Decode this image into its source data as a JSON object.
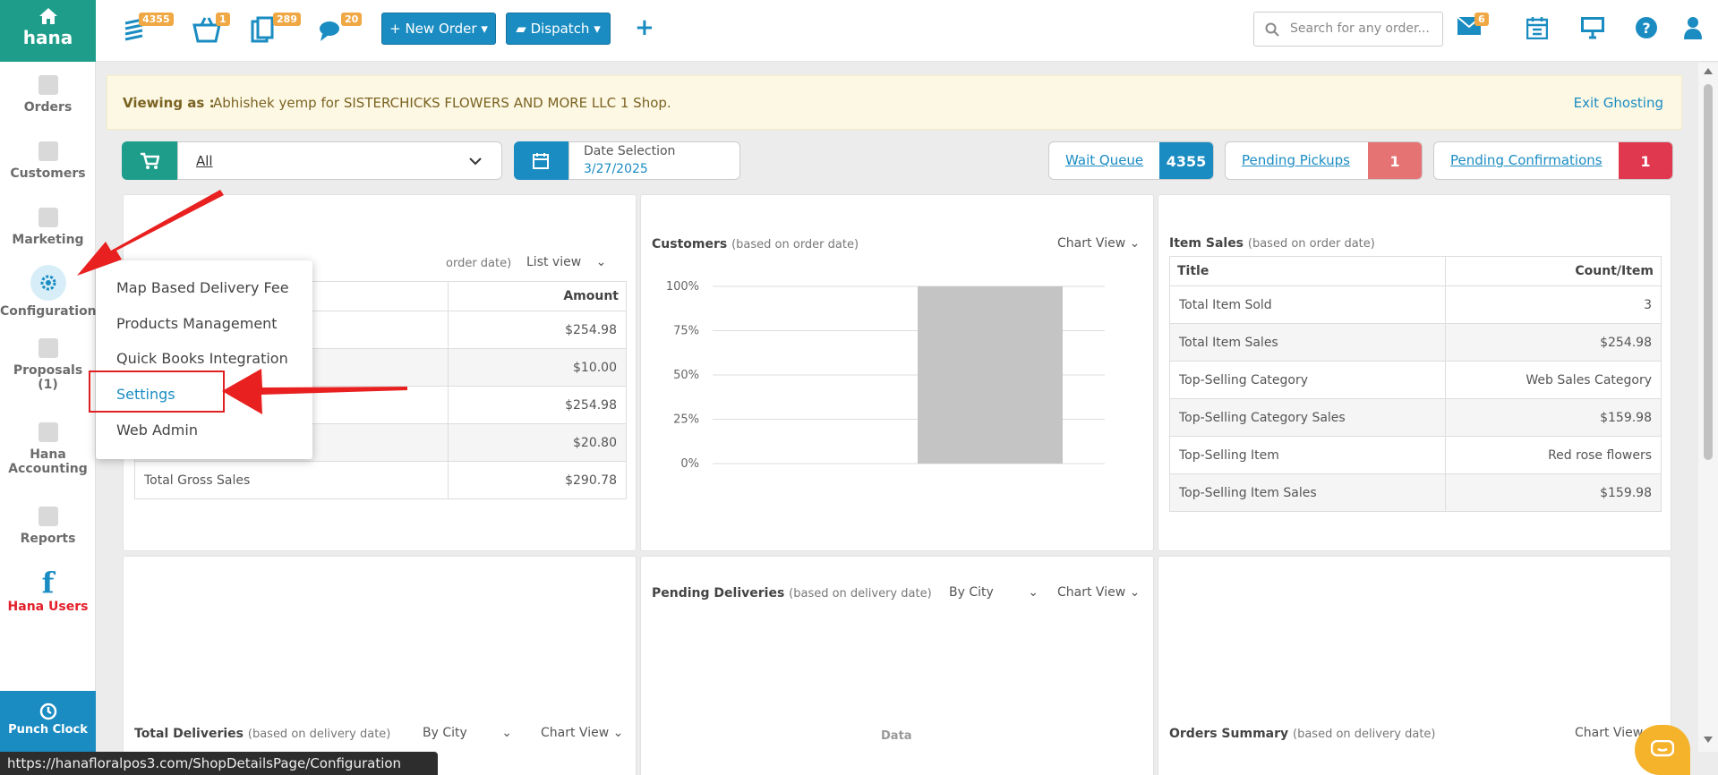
{
  "sidebar": {
    "logo": "hana",
    "items": [
      {
        "label": "Orders",
        "icon": "orders-icon"
      },
      {
        "label": "Customers",
        "icon": "customers-icon"
      },
      {
        "label": "Marketing",
        "icon": "marketing-icon"
      },
      {
        "label": "Configuration",
        "icon": "gear-icon"
      },
      {
        "label": "Proposals",
        "sub": "(1)",
        "icon": "proposals-icon"
      },
      {
        "label": "Hana",
        "sub": "Accounting",
        "icon": "accounting-icon"
      },
      {
        "label": "Reports",
        "icon": "reports-icon"
      },
      {
        "label": "Hana Users",
        "icon": "facebook-icon"
      }
    ],
    "punch_clock": "Punch Clock"
  },
  "topbar": {
    "badges": {
      "orders": "4355",
      "cart": "1",
      "documents": "289",
      "messages": "20",
      "mail": "6"
    },
    "new_order": "+ New Order ▾",
    "dispatch": "Dispatch ▾",
    "search_placeholder": "Search for any order..."
  },
  "banner": {
    "label": "Viewing as :",
    "message": "Abhishek yemp for SISTERCHICKS FLOWERS AND MORE LLC 1 Shop.",
    "exit": "Exit Ghosting"
  },
  "filters": {
    "shop": "All",
    "date_title": "Date Selection",
    "date_value": "3/27/2025",
    "wait_queue": {
      "label": "Wait Queue",
      "count": "4355"
    },
    "pending_pickups": {
      "label": "Pending Pickups",
      "count": "1"
    },
    "pending_confirmations": {
      "label": "Pending Confirmations",
      "count": "1"
    }
  },
  "sales_card": {
    "title_suffix": "order date)",
    "view": "List view",
    "col_amount": "Amount",
    "rows": [
      "$254.98",
      "$10.00",
      "$254.98",
      "$20.80"
    ],
    "total_label": "Total Gross Sales",
    "total_value": "$290.78"
  },
  "customers_card": {
    "title": "Customers",
    "sub": "(based on order date)",
    "view": "Chart View"
  },
  "chart_data": {
    "type": "bar",
    "title": "Customers",
    "categories": [
      ""
    ],
    "values": [
      100
    ],
    "ylim": [
      0,
      100
    ],
    "yticks": [
      "100%",
      "75%",
      "50%",
      "25%",
      "0%"
    ],
    "bar_color": "#c4c4c4"
  },
  "item_sales": {
    "title": "Item Sales",
    "sub": "(based on order date)",
    "col_title": "Title",
    "col_count": "Count/Item",
    "rows": [
      [
        "Total Item Sold",
        "3"
      ],
      [
        "Total Item Sales",
        "$254.98"
      ],
      [
        "Top-Selling Category",
        "Web Sales Category"
      ],
      [
        "Top-Selling Category Sales",
        "$159.98"
      ],
      [
        "Top-Selling Item",
        "Red rose flowers"
      ],
      [
        "Top-Selling Item Sales",
        "$159.98"
      ]
    ]
  },
  "pending_deliveries": {
    "title": "Pending Deliveries",
    "sub": "(based on delivery date)",
    "filter": "By City",
    "view": "Chart View",
    "empty": "Data"
  },
  "total_deliveries": {
    "title": "Total Deliveries",
    "sub": "(based on delivery date)",
    "filter": "By City",
    "view": "Chart View"
  },
  "orders_summary": {
    "title": "Orders Summary",
    "sub": "(based on delivery date)",
    "view": "Chart View"
  },
  "config_menu": [
    "Map Based Delivery Fee",
    "Products Management",
    "Quick Books Integration",
    "Settings",
    "Web Admin"
  ],
  "status_url": "https://hanafloralpos3.com/ShopDetailsPage/Configuration"
}
